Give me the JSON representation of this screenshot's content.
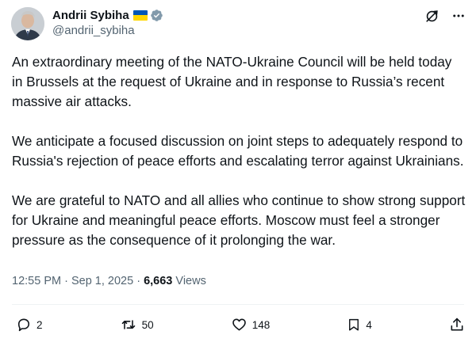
{
  "author": {
    "name": "Andrii Sybiha",
    "handle": "@andrii_sybiha"
  },
  "tweet": {
    "paragraphs": [
      "An extraordinary meeting of the NATO-Ukraine Council will be held today in Brussels at the request of Ukraine and in response to Russia’s recent massive air attacks.",
      "We anticipate a focused discussion on joint steps to adequately respond to Russia's rejection of peace efforts and escalating terror against Ukrainians.",
      "We are grateful to NATO and all allies who continue to show strong support for Ukraine and meaningful peace efforts. Moscow must feel a stronger pressure as the consequence of it prolonging the war."
    ],
    "time": "12:55 PM",
    "date": "Sep 1, 2025",
    "views_count": "6,663",
    "views_label": "Views"
  },
  "actions": {
    "replies": "2",
    "reposts": "50",
    "likes": "148",
    "bookmarks": "4"
  },
  "colors": {
    "text": "#0f1419",
    "muted": "#536471",
    "verified": "#1d9bf0",
    "flag_blue": "#0057b7",
    "flag_yellow": "#ffd700"
  }
}
